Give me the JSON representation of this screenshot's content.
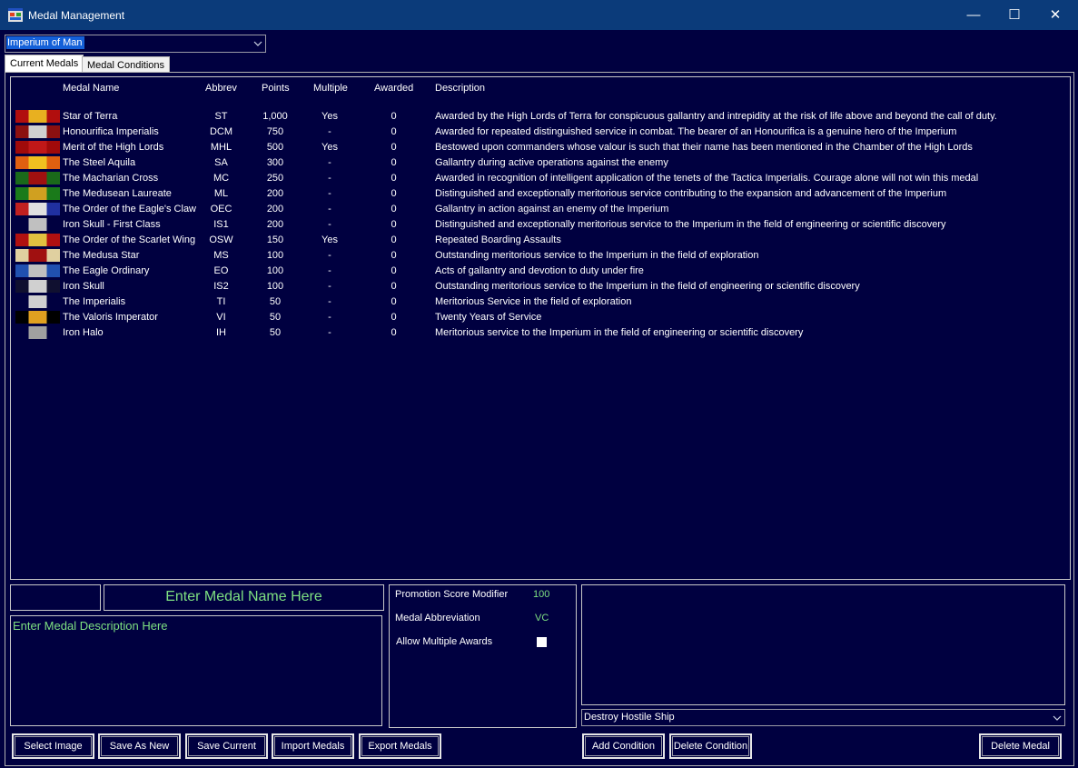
{
  "window": {
    "title": "Medal Management",
    "controls": [
      "—",
      "☐",
      "✕"
    ]
  },
  "faction_select": {
    "value": "Imperium of Man"
  },
  "tabs": [
    {
      "label": "Current Medals"
    },
    {
      "label": "Medal Conditions"
    }
  ],
  "columns": {
    "name": "Medal Name",
    "abbrev": "Abbrev",
    "points": "Points",
    "multiple": "Multiple",
    "awarded": "Awarded",
    "description": "Description"
  },
  "medals": [
    {
      "name": "Star of Terra",
      "abbrev": "ST",
      "points": "1,000",
      "multiple": "Yes",
      "awarded": "0",
      "description": "Awarded by the High Lords of Terra for conspicuous gallantry and intrepidity at the risk of life above and beyond the call of duty.",
      "ribbon": [
        "#b10e0e",
        "#e8b020",
        "#b10e0e"
      ]
    },
    {
      "name": "Honourifica Imperialis",
      "abbrev": "DCM",
      "points": "750",
      "multiple": "-",
      "awarded": "0",
      "description": "Awarded for repeated distinguished service in combat. The bearer of an Honourifica is a genuine hero of the Imperium",
      "ribbon": [
        "#8b1010",
        "#d0d0d0",
        "#8b1010"
      ]
    },
    {
      "name": "Merit of the High Lords",
      "abbrev": "MHL",
      "points": "500",
      "multiple": "Yes",
      "awarded": "0",
      "description": "Bestowed upon commanders whose valour is such that their name has been mentioned in the Chamber of the High Lords",
      "ribbon": [
        "#a00a0a",
        "#c01818",
        "#a00a0a"
      ]
    },
    {
      "name": "The Steel Aquila",
      "abbrev": "SA",
      "points": "300",
      "multiple": "-",
      "awarded": "0",
      "description": "Gallantry during active operations against the enemy",
      "ribbon": [
        "#e06010",
        "#f0c020",
        "#e06010"
      ]
    },
    {
      "name": "The Macharian Cross",
      "abbrev": "MC",
      "points": "250",
      "multiple": "-",
      "awarded": "0",
      "description": "Awarded in recognition of intelligent application of the tenets of the Tactica Imperialis. Courage alone will not win this medal",
      "ribbon": [
        "#1a6a1a",
        "#a01010",
        "#1a6a1a"
      ]
    },
    {
      "name": "The Medusean Laureate",
      "abbrev": "ML",
      "points": "200",
      "multiple": "-",
      "awarded": "0",
      "description": "Distinguished and exceptionally meritorious service contributing to the expansion and advancement of the Imperium",
      "ribbon": [
        "#1a7a1a",
        "#d0a020",
        "#1a7a1a"
      ]
    },
    {
      "name": "The Order of the Eagle's Claw",
      "abbrev": "OEC",
      "points": "200",
      "multiple": "-",
      "awarded": "0",
      "description": "Gallantry in action against an enemy of the Imperium",
      "ribbon": [
        "#c02020",
        "#e0e0e0",
        "#2030a0"
      ]
    },
    {
      "name": "Iron Skull - First Class",
      "abbrev": "IS1",
      "points": "200",
      "multiple": "-",
      "awarded": "0",
      "description": "Distinguished and exceptionally meritorious service to the Imperium in the field of engineering or scientific discovery",
      "ribbon": [
        "#000040",
        "#c0c0c0",
        "#000040"
      ]
    },
    {
      "name": "The Order of the Scarlet Wing",
      "abbrev": "OSW",
      "points": "150",
      "multiple": "Yes",
      "awarded": "0",
      "description": "Repeated Boarding Assaults",
      "ribbon": [
        "#b01010",
        "#e0c040",
        "#b01010"
      ]
    },
    {
      "name": "The Medusa Star",
      "abbrev": "MS",
      "points": "100",
      "multiple": "-",
      "awarded": "0",
      "description": "Outstanding meritorious service to the Imperium in the field of exploration",
      "ribbon": [
        "#e0d0a0",
        "#a01010",
        "#e0d0a0"
      ]
    },
    {
      "name": "The Eagle Ordinary",
      "abbrev": "EO",
      "points": "100",
      "multiple": "-",
      "awarded": "0",
      "description": "Acts of gallantry and devotion to duty under fire",
      "ribbon": [
        "#2050b0",
        "#c0c0c0",
        "#2050b0"
      ]
    },
    {
      "name": "Iron Skull",
      "abbrev": "IS2",
      "points": "100",
      "multiple": "-",
      "awarded": "0",
      "description": "Outstanding meritorious service to the Imperium in the field of engineering or scientific discovery",
      "ribbon": [
        "#101030",
        "#d0d0d0",
        "#101030"
      ]
    },
    {
      "name": "The Imperialis",
      "abbrev": "TI",
      "points": "50",
      "multiple": "-",
      "awarded": "0",
      "description": "Meritorious Service in the field of exploration",
      "ribbon": [
        "#000040",
        "#d0d0d0",
        "#000040"
      ]
    },
    {
      "name": "The Valoris Imperator",
      "abbrev": "VI",
      "points": "50",
      "multiple": "-",
      "awarded": "0",
      "description": "Twenty Years of Service",
      "ribbon": [
        "#000000",
        "#e0a020",
        "#000000"
      ]
    },
    {
      "name": "Iron Halo",
      "abbrev": "IH",
      "points": "50",
      "multiple": "-",
      "awarded": "0",
      "description": "Meritorious service to the Imperium in the field of engineering or scientific discovery",
      "ribbon": [
        "#000040",
        "#a0a0a0",
        "#000040"
      ]
    }
  ],
  "editor": {
    "name_placeholder": "Enter Medal Name Here",
    "description_placeholder": "Enter Medal Description Here",
    "promotion_label": "Promotion Score Modifier",
    "promotion_value": "100",
    "abbrev_label": "Medal Abbreviation",
    "abbrev_value": "VC",
    "multiple_label": "Allow Multiple Awards",
    "multiple_checked": false
  },
  "condition_select": {
    "value": "Destroy Hostile Ship"
  },
  "buttons": {
    "select_image": "Select Image",
    "save_as_new": "Save As New",
    "save_current": "Save Current",
    "import": "Import Medals",
    "export": "Export Medals",
    "add_condition": "Add Condition",
    "delete_condition": "Delete Condition",
    "delete_medal": "Delete Medal"
  }
}
